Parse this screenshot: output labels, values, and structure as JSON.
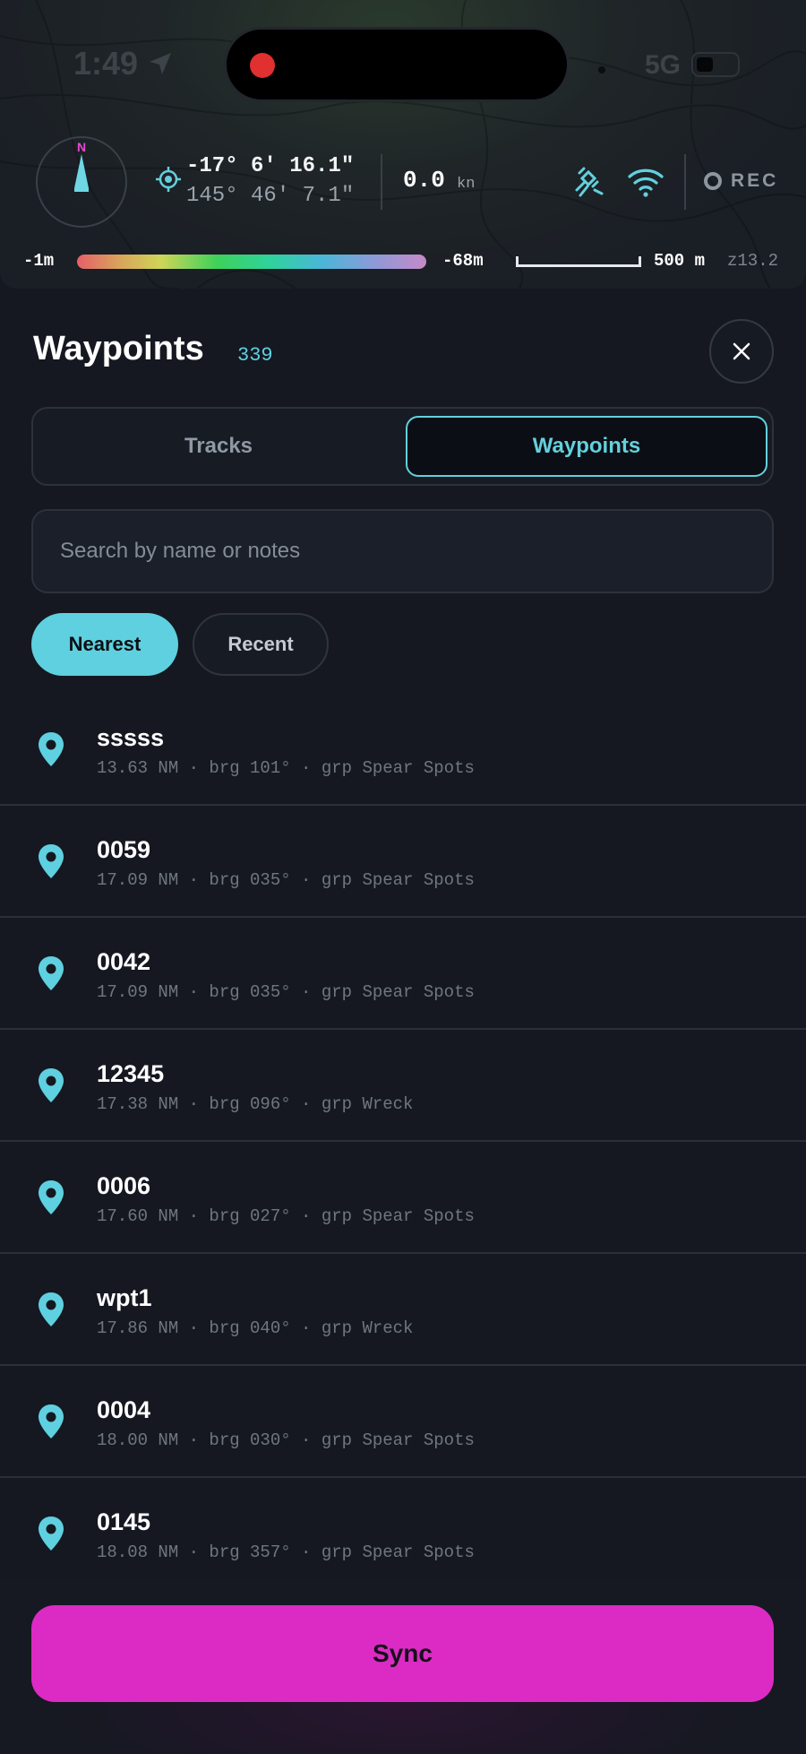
{
  "status_bar": {
    "time": "1:49",
    "network": "5G"
  },
  "nav": {
    "compass_label": "N",
    "latitude": "-17° 6' 16.1\"",
    "longitude": "145° 46' 7.1\"",
    "speed": "0.0",
    "speed_unit": "kn",
    "record_label": "REC"
  },
  "map": {
    "depth_min": "-1m",
    "depth_max": "-68m",
    "scale": "500 m",
    "zoom": "z13.2"
  },
  "sheet": {
    "title": "Waypoints",
    "count": "339",
    "tabs": [
      {
        "label": "Tracks",
        "active": false
      },
      {
        "label": "Waypoints",
        "active": true
      }
    ],
    "search_placeholder": "Search by name or notes",
    "sort_chips": [
      {
        "label": "Nearest",
        "active": true
      },
      {
        "label": "Recent",
        "active": false
      }
    ],
    "waypoints": [
      {
        "name": "sssss",
        "meta": "13.63 NM · brg 101° · grp Spear Spots"
      },
      {
        "name": "0059",
        "meta": "17.09 NM · brg 035° · grp Spear Spots"
      },
      {
        "name": "0042",
        "meta": "17.09 NM · brg 035° · grp Spear Spots"
      },
      {
        "name": "12345",
        "meta": "17.38 NM · brg 096° · grp Wreck"
      },
      {
        "name": "0006",
        "meta": "17.60 NM · brg 027° · grp Spear Spots"
      },
      {
        "name": "wpt1",
        "meta": "17.86 NM · brg 040° · grp Wreck"
      },
      {
        "name": "0004",
        "meta": "18.00 NM · brg 030° · grp Spear Spots"
      },
      {
        "name": "0145",
        "meta": "18.08 NM · brg 357° · grp Spear Spots"
      }
    ],
    "sync_label": "Sync"
  },
  "colors": {
    "accent": "#5fd0df",
    "sync": "#dc2bc4",
    "background": "#151821"
  }
}
